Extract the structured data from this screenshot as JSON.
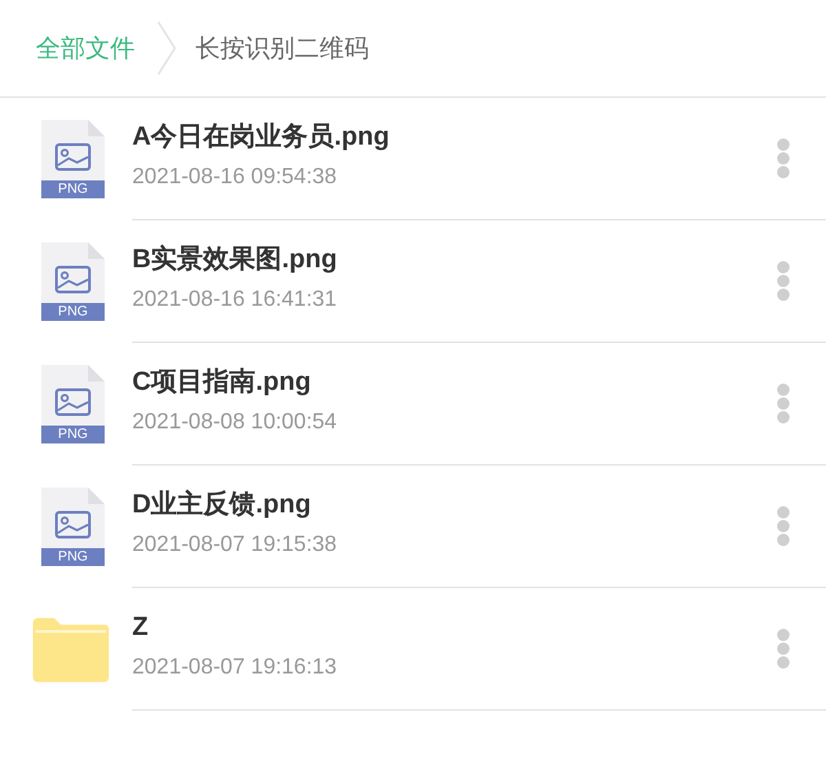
{
  "breadcrumb": [
    {
      "label": "全部文件",
      "selected": false
    },
    {
      "label": "长按识别二维码",
      "selected": true
    }
  ],
  "files": [
    {
      "kind": "png",
      "badge": "PNG",
      "name": "A今日在岗业务员.png",
      "date": "2021-08-16 09:54:38"
    },
    {
      "kind": "png",
      "badge": "PNG",
      "name": "B实景效果图.png",
      "date": "2021-08-16 16:41:31"
    },
    {
      "kind": "png",
      "badge": "PNG",
      "name": "C项目指南.png",
      "date": "2021-08-08 10:00:54"
    },
    {
      "kind": "png",
      "badge": "PNG",
      "name": "D业主反馈.png",
      "date": "2021-08-07 19:15:38"
    },
    {
      "kind": "folder",
      "name": "Z",
      "date": "2021-08-07 19:16:13"
    }
  ]
}
